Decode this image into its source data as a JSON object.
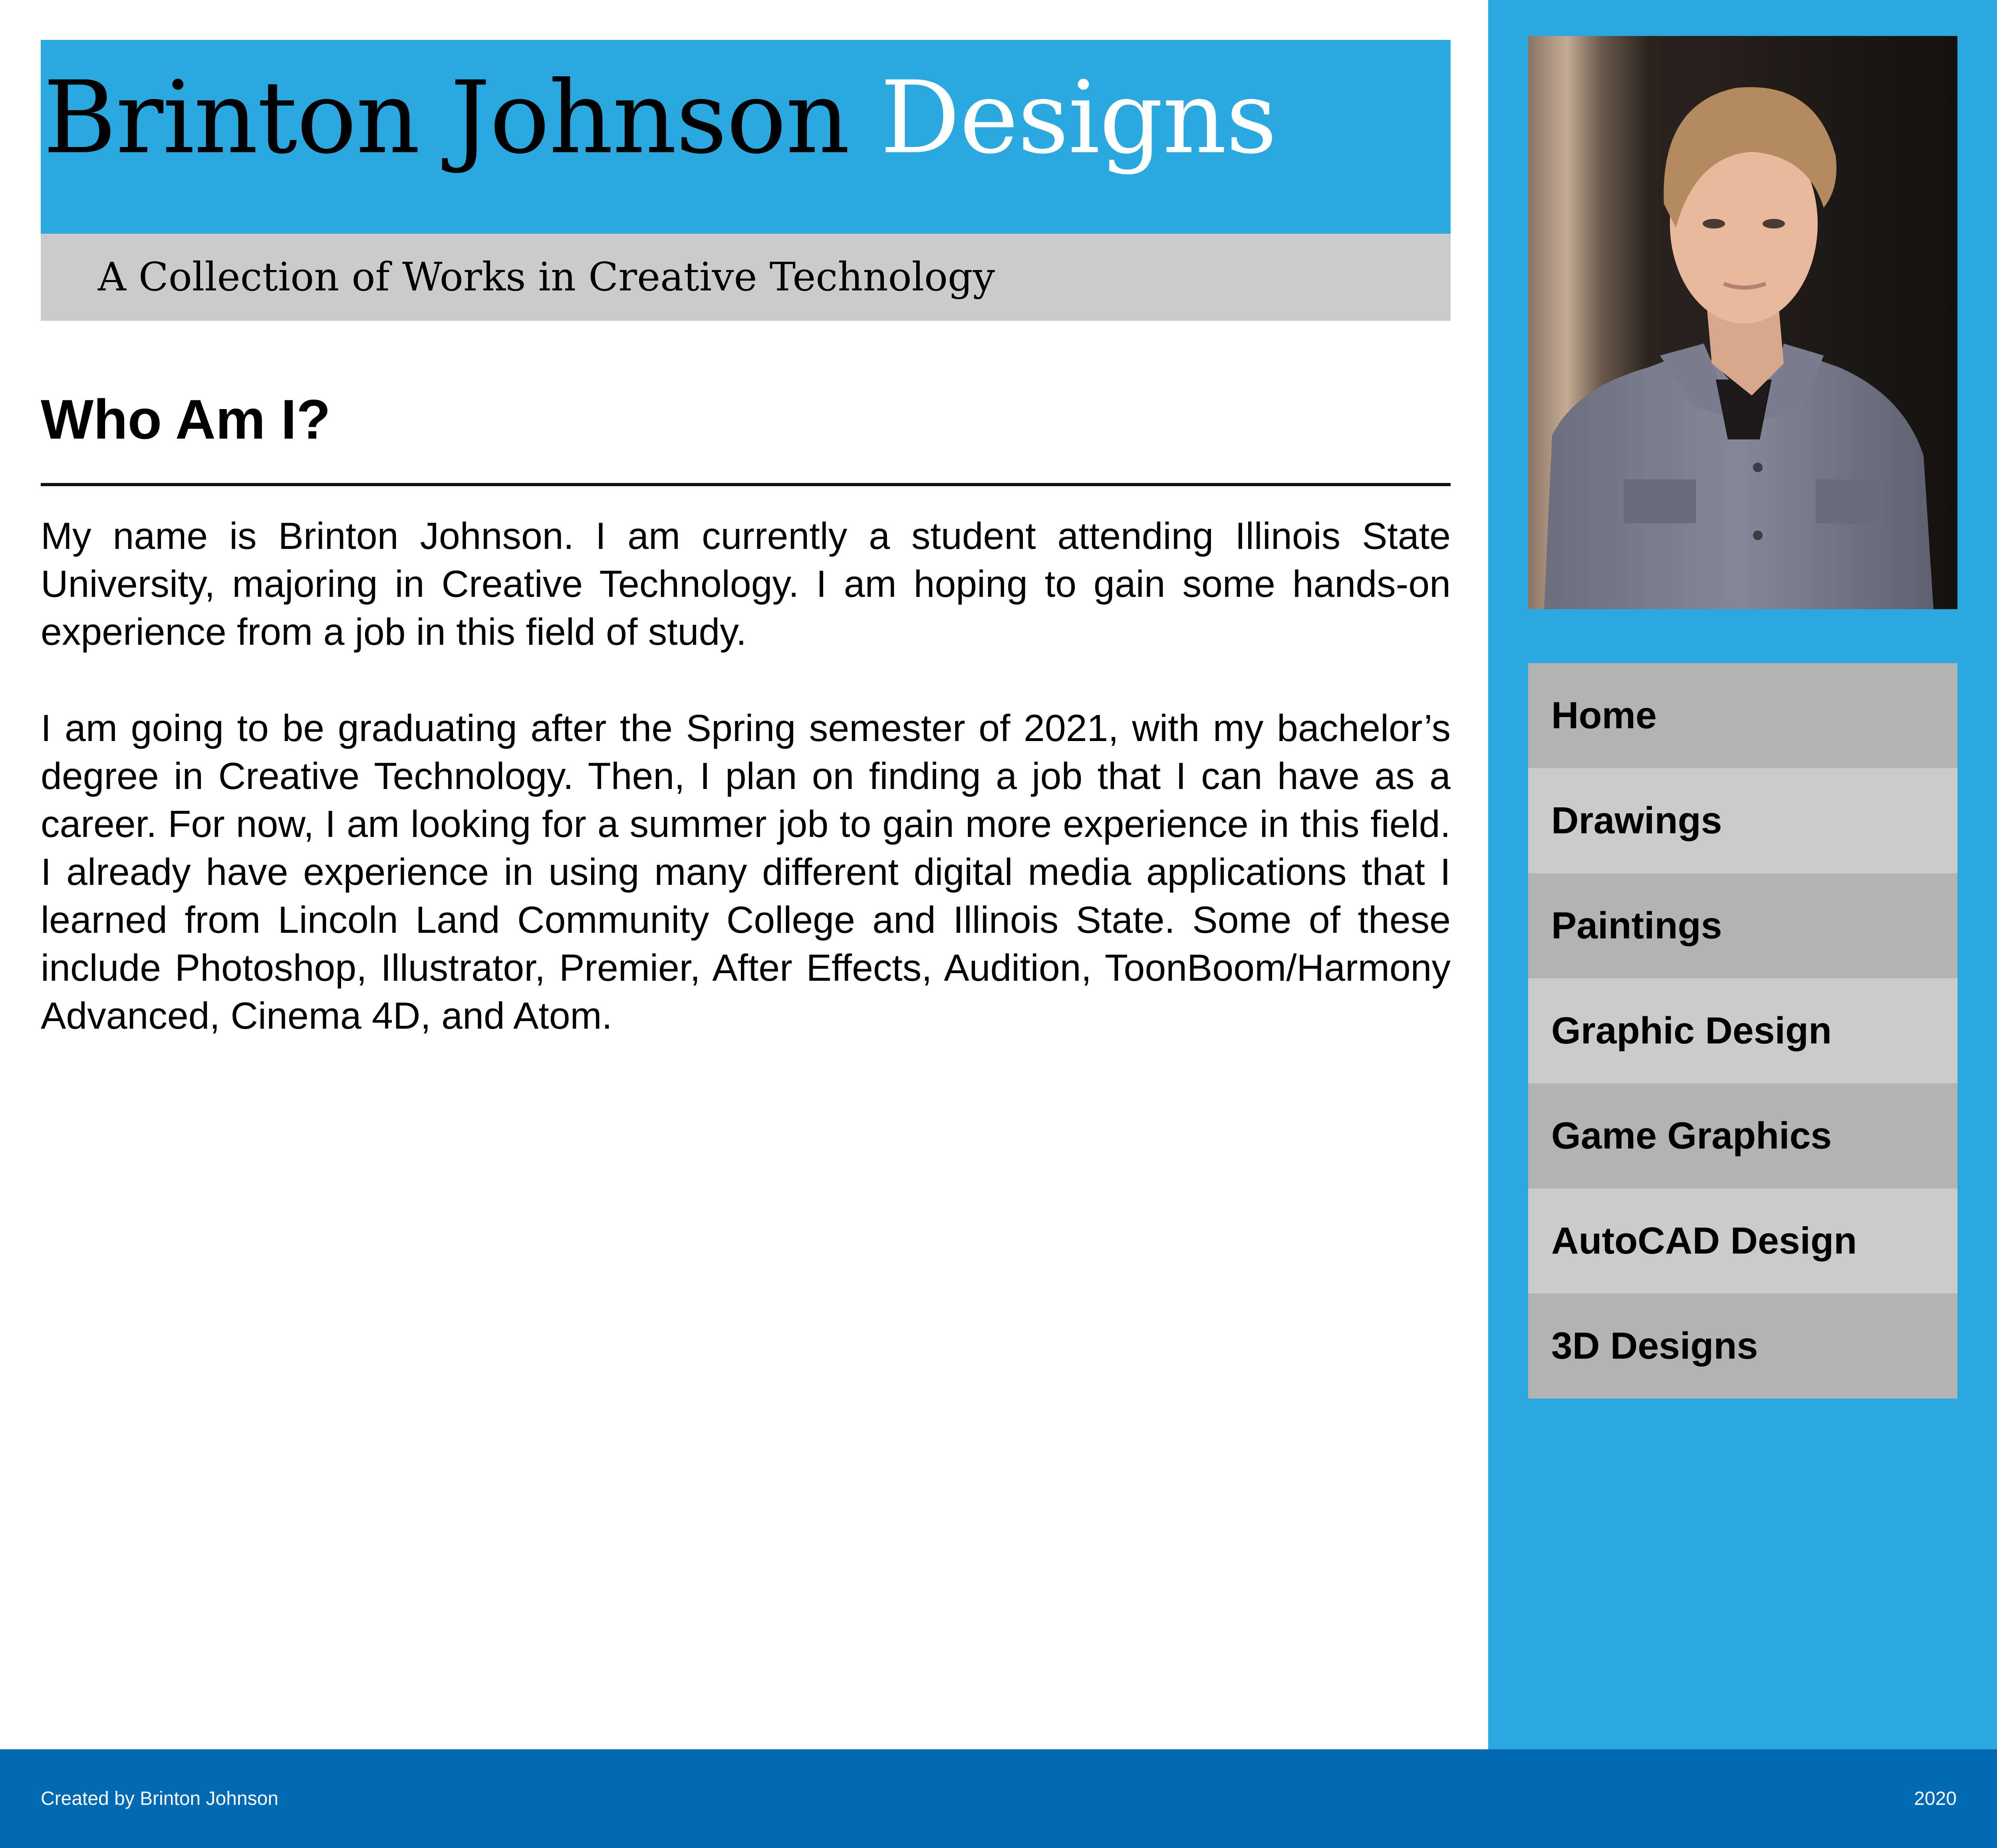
{
  "header": {
    "title_primary": "Brinton Johnson",
    "title_accent": "Designs",
    "subtitle": "A Collection of Works in Creative Technology"
  },
  "main": {
    "heading": "Who Am I?",
    "paragraphs": [
      "My name is Brinton Johnson. I am currently a student attending Illinois State University, majoring in Creative Technology. I am hoping to gain some hands-on experience from a job in this field of study.",
      "I am going to be graduating after the Spring semester of 2021, with my bachelor’s degree in Creative Technology. Then, I plan on finding a job that I can have as a career. For now, I am looking for a summer job to gain more experience in this field. I already have experience in using many different digital media applications that I learned from Lincoln Land Community College and Illinois State. Some of these include Photoshop, Illustrator, Premier, After Effects, Audition, ToonBoom/Harmony Advanced, Cinema 4D, and Atom."
    ]
  },
  "sidebar": {
    "nav": [
      {
        "label": "Home"
      },
      {
        "label": "Drawings"
      },
      {
        "label": "Paintings"
      },
      {
        "label": "Graphic Design"
      },
      {
        "label": "Game Graphics"
      },
      {
        "label": "AutoCAD Design"
      },
      {
        "label": "3D Designs"
      }
    ]
  },
  "footer": {
    "credit": "Created by Brinton Johnson",
    "year": "2020"
  },
  "colors": {
    "header_blue": "#29a9e0",
    "footer_blue": "#0069b4",
    "subtitle_gray": "#cbcbcb",
    "nav_dark_gray": "#b3b3b3",
    "nav_light_gray": "#cbcbcb"
  }
}
